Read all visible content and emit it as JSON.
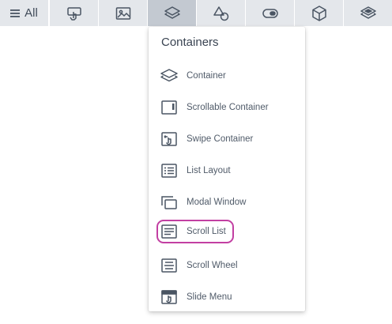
{
  "toolbar": {
    "all_label": "All",
    "buttons": [
      {
        "icon": "tap-gesture-icon"
      },
      {
        "icon": "image-icon"
      },
      {
        "icon": "layers-icon",
        "active": true
      },
      {
        "icon": "shapes-icon"
      },
      {
        "icon": "toggle-icon"
      },
      {
        "icon": "cube-icon"
      },
      {
        "icon": "stack-icon"
      }
    ]
  },
  "panel": {
    "title": "Containers",
    "items": [
      {
        "label": "Container",
        "icon": "layers-icon"
      },
      {
        "label": "Scrollable Container",
        "icon": "scrollable-container-icon"
      },
      {
        "label": "Swipe Container",
        "icon": "swipe-container-icon"
      },
      {
        "label": "List Layout",
        "icon": "list-layout-icon"
      },
      {
        "label": "Modal Window",
        "icon": "modal-window-icon"
      },
      {
        "label": "Scroll List",
        "icon": "scroll-list-icon",
        "highlighted": true
      },
      {
        "label": "Scroll Wheel",
        "icon": "scroll-wheel-icon"
      },
      {
        "label": "Slide Menu",
        "icon": "slide-menu-icon"
      }
    ]
  },
  "colors": {
    "toolbar_bg": "#e4e7eb",
    "toolbar_active_bg": "#c3c9d1",
    "icon": "#4a5563",
    "highlight": "#c23fa2"
  }
}
